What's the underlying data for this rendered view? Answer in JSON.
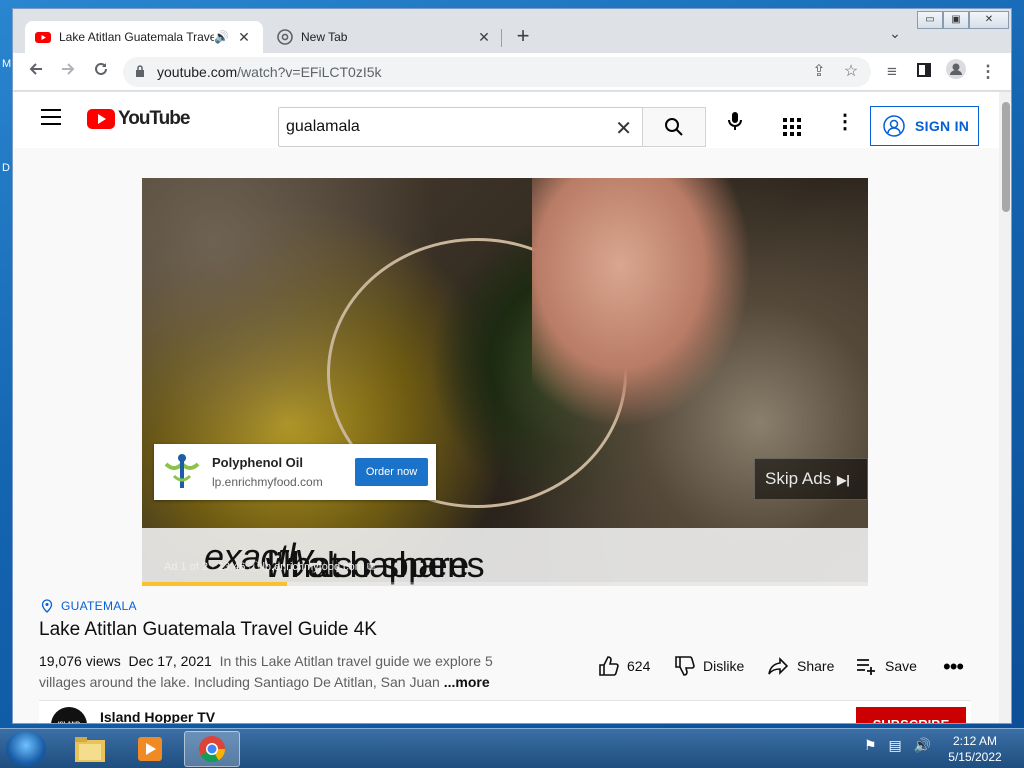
{
  "desktop": {
    "glyph1": "M",
    "glyph2": "D"
  },
  "browser": {
    "tabs": [
      {
        "title": "Lake Atitlan Guatemala Trave",
        "close": "✕",
        "audio": "🔊"
      },
      {
        "title": "New Tab",
        "close": "✕"
      }
    ],
    "new_tab": "+",
    "tab_search": "⌄",
    "window_controls": {
      "minimize": "▭",
      "restore": "▣",
      "close": "✕"
    },
    "url_host": "youtube.com",
    "url_path": "/watch?v=EFiLCT0zI5k"
  },
  "youtube": {
    "logo_text": "YouTube",
    "search_value": "gualamala",
    "sign_in": "SIGN IN",
    "ad": {
      "name": "Polyphenol Oil",
      "domain": "lp.enrichmyfood.com",
      "cta": "Order now",
      "skip": "Skip Ads",
      "meta": "Ad 1 of 2 · 13:46  ⓘ  lp.enrichmyfood.com ⧉",
      "progress": 0.2
    },
    "subtitle_pre": "I’ll also share ",
    "subtitle_em": "exactly",
    "subtitle_post": " what happens",
    "tag": "GUATEMALA",
    "title": "Lake Atitlan Guatemala Travel Guide 4K",
    "views": "19,076 views",
    "date": "Dec 17, 2021",
    "description": "In this Lake Atitlan travel guide we explore 5 villages around the lake. Including Santiago De Atitlan, San Juan",
    "more": "...more",
    "likes": "624",
    "dislike": "Dislike",
    "share": "Share",
    "save": "Save",
    "more_actions": "•••",
    "channel": "Island Hopper TV",
    "channel_avatar": "ISLAND HOPPER",
    "subscribe": "SUBSCRIBE"
  },
  "taskbar": {
    "time": "2:12 AM",
    "date": "5/15/2022"
  },
  "colors": {
    "yt_red": "#ff0000",
    "link_blue": "#065fd4",
    "ad_blue": "#1a73c8",
    "progress_yellow": "#fbc02d"
  }
}
